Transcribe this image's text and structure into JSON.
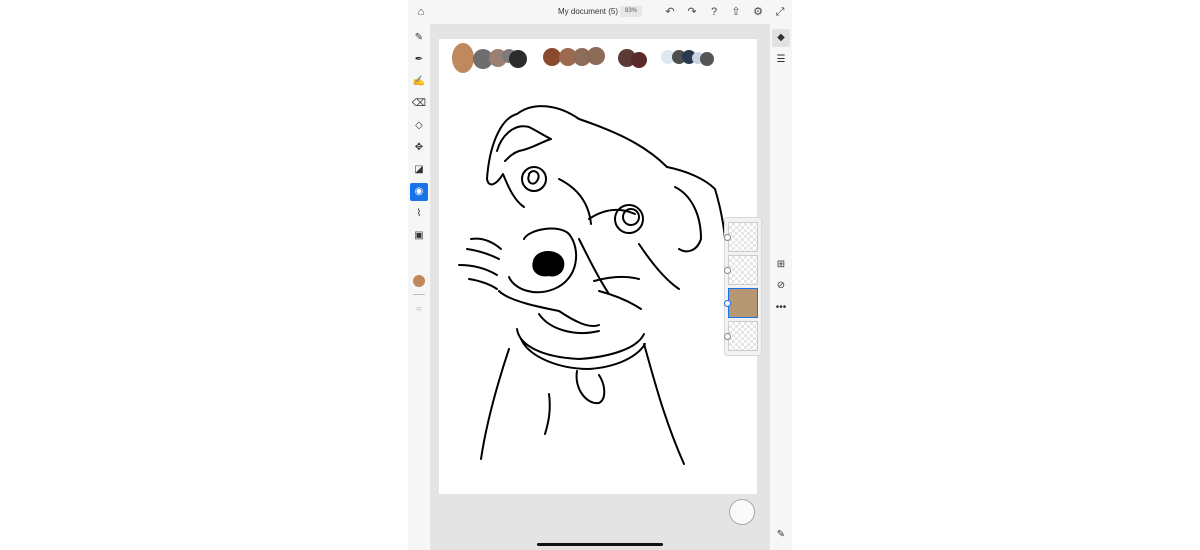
{
  "app": {
    "document_title": "My document (5)",
    "zoom_level": "83%"
  },
  "toolbar": {
    "icons": [
      "home-icon",
      "undo-icon",
      "redo-icon",
      "help-icon",
      "share-icon",
      "settings-icon",
      "fullscreen-icon"
    ]
  },
  "tools": {
    "icons": [
      "pixel-brush-icon",
      "live-brush-icon",
      "vector-brush-icon",
      "eraser-icon",
      "shape-icon",
      "transform-icon",
      "fill-selection-icon",
      "fill-icon",
      "eyedropper-icon",
      "image-icon",
      "current-color",
      "smudge-icon"
    ],
    "active": "fill-icon",
    "current_color": "#c0895b"
  },
  "palette": {
    "swatches": [
      "#c0895b",
      "#6e6e6e",
      "#9a8070",
      "#7b7b7b",
      "#2c2c2c",
      "#8a4a2e",
      "#9c6a4e",
      "#8f6b5a",
      "#8c6a58",
      "#5c3a36",
      "#5a2a2a",
      "#dce8f2",
      "#4e4e4e",
      "#2a3a4e",
      "#c9d6e2",
      "#555555"
    ]
  },
  "layers": {
    "count": 4,
    "active_index": 2
  },
  "rightbar": {
    "icons": [
      "layers-icon",
      "adjustments-icon",
      "add-layer-icon",
      "visibility-icon",
      "more-icon",
      "edit-icon"
    ]
  }
}
